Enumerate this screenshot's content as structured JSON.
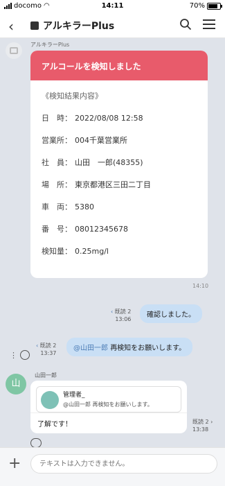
{
  "status": {
    "carrier": "docomo",
    "time": "14:11",
    "battery": "70%"
  },
  "header": {
    "title": "アルキラーPlus"
  },
  "bot_message": {
    "sender": "アルキラーPlus",
    "card_title": "アルコールを検知しました",
    "section": "《検知結果内容》",
    "rows": [
      {
        "label": "日　時：",
        "value": "2022/08/08 12:58"
      },
      {
        "label": "営業所：",
        "value": "004千葉営業所"
      },
      {
        "label": "社　員：",
        "value": "山田　一郎(48355)"
      },
      {
        "label": "場　所：",
        "value": "東京都港区三田二丁目"
      },
      {
        "label": "車　両：",
        "value": "5380"
      },
      {
        "label": "番　号：",
        "value": "08012345678"
      },
      {
        "label": "検知量：",
        "value": "0.25mg/l"
      }
    ],
    "time": "14:10"
  },
  "out_message_1": {
    "text": "確認しました。",
    "read": "既読 2",
    "time": "13:06"
  },
  "out_message_2": {
    "mention": "@山田一郎",
    "text": "再検知をお願いします。",
    "read": "既読 2",
    "time": "13:37"
  },
  "tools": {
    "more": "⋮"
  },
  "user_message": {
    "sender": "山田一郎",
    "avatar": "山",
    "quote_name": "管理者_",
    "quote_text": "@山田一郎 再検知をお願いします。",
    "text": "了解です！",
    "read": "既読 2",
    "time": "13:38"
  },
  "input": {
    "placeholder": "テキストは入力できません。"
  }
}
